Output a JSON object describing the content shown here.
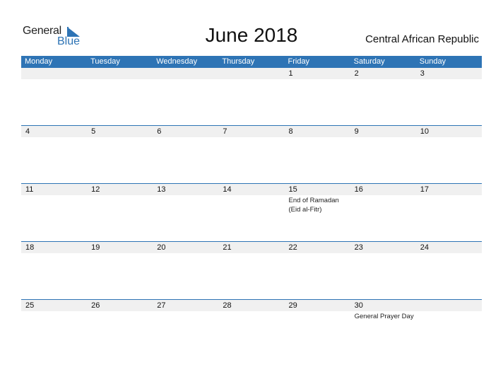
{
  "logo": {
    "general": "General",
    "blue": "Blue"
  },
  "title": "June 2018",
  "country": "Central African Republic",
  "weekdays": [
    "Monday",
    "Tuesday",
    "Wednesday",
    "Thursday",
    "Friday",
    "Saturday",
    "Sunday"
  ],
  "weeks": [
    [
      {
        "d": ""
      },
      {
        "d": ""
      },
      {
        "d": ""
      },
      {
        "d": ""
      },
      {
        "d": "1"
      },
      {
        "d": "2"
      },
      {
        "d": "3"
      }
    ],
    [
      {
        "d": "4"
      },
      {
        "d": "5"
      },
      {
        "d": "6"
      },
      {
        "d": "7"
      },
      {
        "d": "8"
      },
      {
        "d": "9"
      },
      {
        "d": "10"
      }
    ],
    [
      {
        "d": "11"
      },
      {
        "d": "12"
      },
      {
        "d": "13"
      },
      {
        "d": "14"
      },
      {
        "d": "15",
        "e": "End of Ramadan (Eid al-Fitr)"
      },
      {
        "d": "16"
      },
      {
        "d": "17"
      }
    ],
    [
      {
        "d": "18"
      },
      {
        "d": "19"
      },
      {
        "d": "20"
      },
      {
        "d": "21"
      },
      {
        "d": "22"
      },
      {
        "d": "23"
      },
      {
        "d": "24"
      }
    ],
    [
      {
        "d": "25"
      },
      {
        "d": "26"
      },
      {
        "d": "27"
      },
      {
        "d": "28"
      },
      {
        "d": "29"
      },
      {
        "d": "30",
        "e": "General Prayer Day"
      },
      {
        "d": ""
      }
    ]
  ],
  "colors": {
    "accent": "#2e74b5",
    "row_band": "#f0f0f0"
  }
}
